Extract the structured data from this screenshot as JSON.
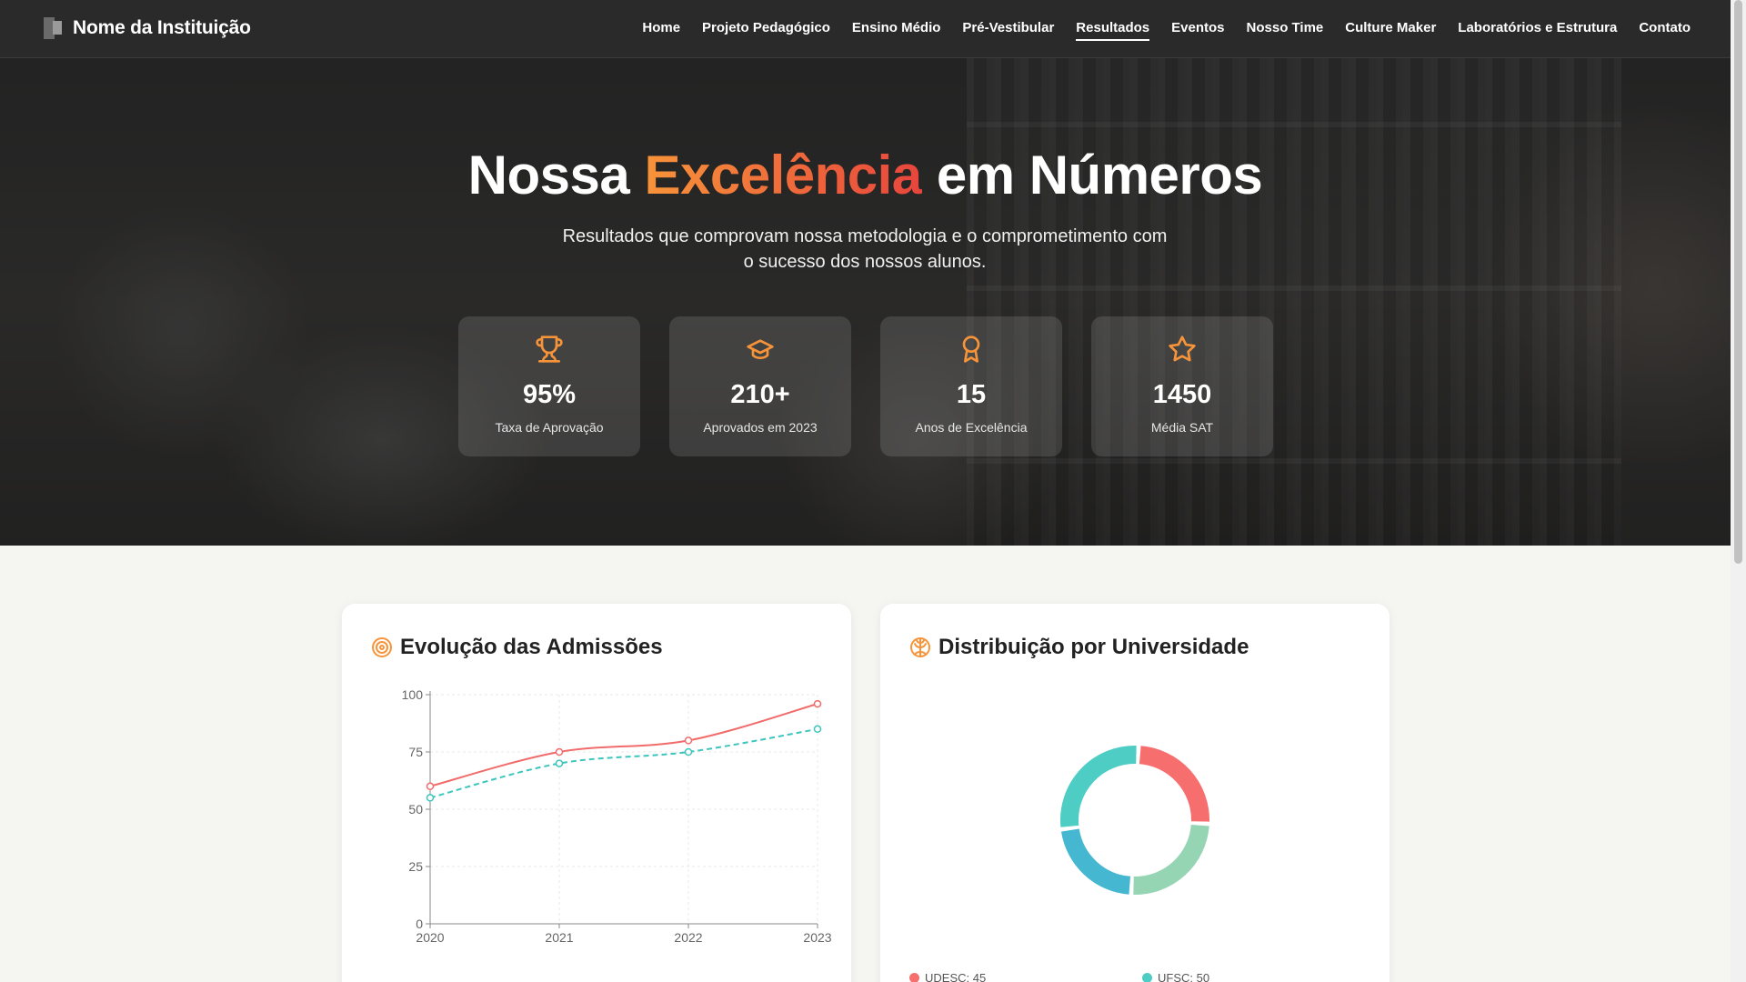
{
  "brand": {
    "name": "Nome da Instituição"
  },
  "nav": {
    "items": [
      {
        "label": "Home"
      },
      {
        "label": "Projeto Pedagógico"
      },
      {
        "label": "Ensino Médio"
      },
      {
        "label": "Pré-Vestibular"
      },
      {
        "label": "Resultados"
      },
      {
        "label": "Eventos"
      },
      {
        "label": "Nosso Time"
      },
      {
        "label": "Culture Maker"
      },
      {
        "label": "Laboratórios e Estrutura"
      },
      {
        "label": "Contato"
      }
    ],
    "active": "Resultados"
  },
  "hero": {
    "title_pre": "Nossa ",
    "title_accent": "Excelência",
    "title_post": " em Números",
    "subtitle": "Resultados que comprovam nossa metodologia e o comprometimento com o sucesso dos nossos alunos.",
    "accent_colors": [
      "#f7943a",
      "#e8453c"
    ]
  },
  "stats": [
    {
      "icon": "trophy-icon",
      "value": "95%",
      "label": "Taxa de Aprovação"
    },
    {
      "icon": "graduation-cap-icon",
      "value": "210+",
      "label": "Aprovados em 2023"
    },
    {
      "icon": "award-icon",
      "value": "15",
      "label": "Anos de Excelência"
    },
    {
      "icon": "star-icon",
      "value": "1450",
      "label": "Média SAT"
    }
  ],
  "cards": {
    "admissions": {
      "title": "Evolução das Admissões",
      "icon": "target-icon"
    },
    "distribution": {
      "title": "Distribuição por Universidade",
      "icon": "brain-icon"
    }
  },
  "chart_data": [
    {
      "type": "line",
      "title": "",
      "xlabel": "",
      "ylabel": "",
      "x": [
        "2020",
        "2021",
        "2022",
        "2023"
      ],
      "ylim": [
        0,
        100
      ],
      "yticks": [
        0,
        25,
        50,
        75,
        100
      ],
      "grid": true,
      "series": [
        {
          "values": [
            60,
            75,
            80,
            96
          ],
          "color": "#f26b6b",
          "style": "solid"
        },
        {
          "values": [
            55,
            70,
            75,
            85
          ],
          "color": "#3cc5bd",
          "style": "dashed"
        }
      ]
    },
    {
      "type": "pie",
      "donut": true,
      "slices": [
        {
          "label": "UDESC",
          "value": 45,
          "color": "#f76e6e"
        },
        {
          "label": "UFSC",
          "value": 50,
          "color": "#4ecdc4"
        },
        {
          "value": 40,
          "color": "#45b7d1"
        },
        {
          "value": 45,
          "color": "#96d5b4"
        }
      ],
      "slice_order": [
        0,
        3,
        2,
        1
      ],
      "legend_labels": [
        "UDESC: 45",
        "UFSC: 50"
      ]
    }
  ]
}
